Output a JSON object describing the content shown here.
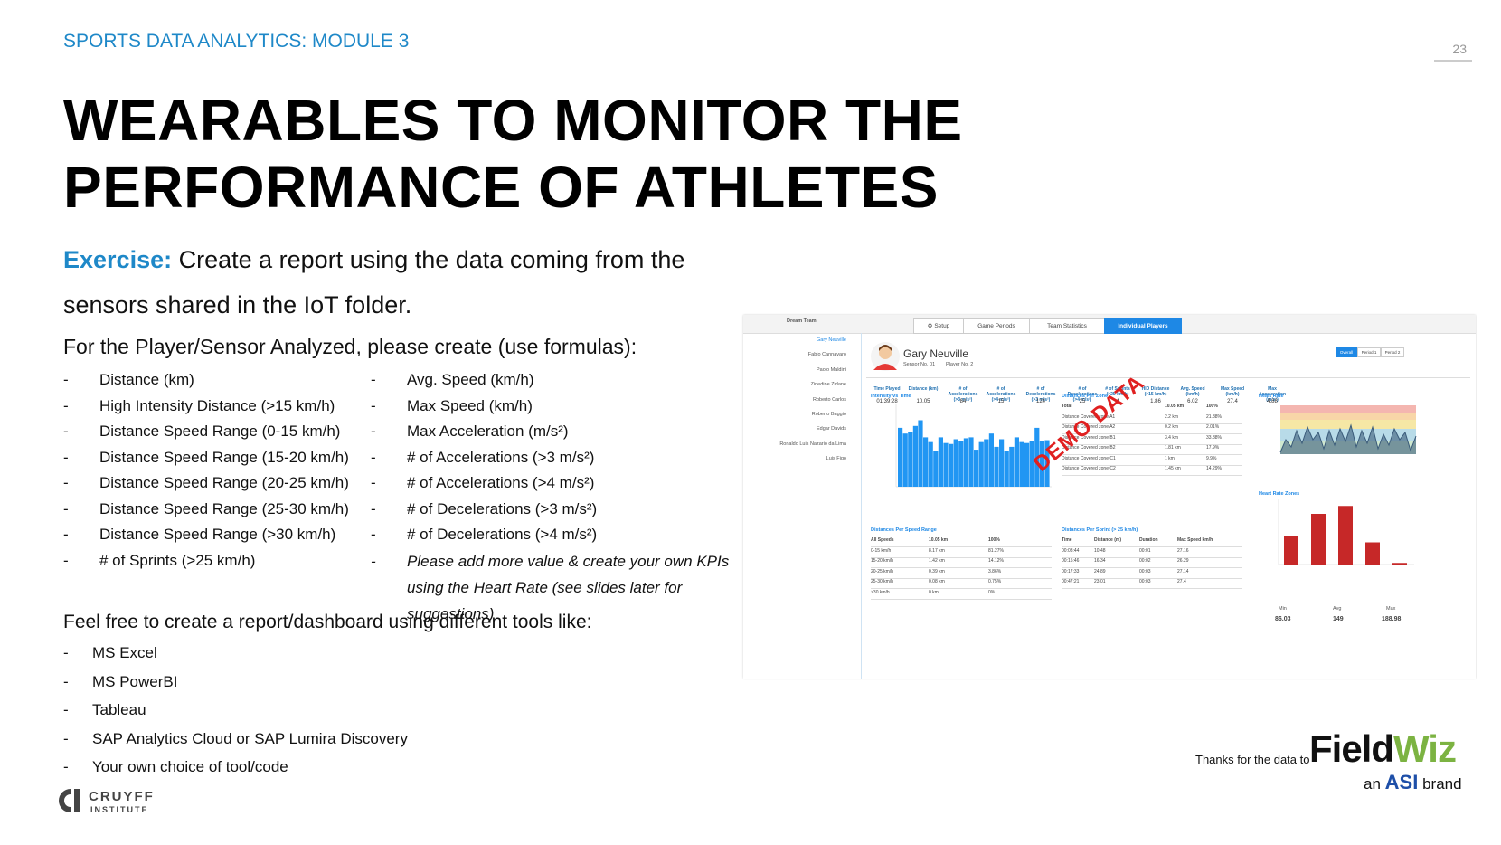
{
  "header": {
    "module": "SPORTS DATA ANALYTICS: MODULE 3",
    "page_number": "23"
  },
  "title": {
    "line1": "WEARABLES TO MONITOR THE",
    "line2": "PERFORMANCE OF ATHLETES"
  },
  "exercise": {
    "label": "Exercise:",
    "text": " Create a report using the data coming from the sensors shared in the IoT folder."
  },
  "analyze_intro": "For the Player/Sensor Analyzed, please create (use formulas):",
  "kpis_left": [
    "Distance (km)",
    "High Intensity Distance (>15 km/h)",
    "Distance Speed Range (0-15 km/h)",
    "Distance Speed Range (15-20 km/h)",
    "Distance Speed Range (20-25 km/h)",
    "Distance Speed Range (25-30 km/h)",
    "Distance Speed Range (>30 km/h)",
    "# of Sprints (>25 km/h)"
  ],
  "kpis_right": [
    "Avg. Speed (km/h)",
    "Max Speed (km/h)",
    "Max Acceleration (m/s²)",
    "# of Accelerations (>3 m/s²)",
    "# of Accelerations (>4 m/s²)",
    "# of Decelerations (>3 m/s²)",
    "# of Decelerations (>4 m/s²)"
  ],
  "kpis_note": "Please add more value & create your own KPIs using the Heart Rate (see slides later for suggestions)",
  "tools_intro": "Feel free to create a report/dashboard using different tools like:",
  "tools": [
    "MS Excel",
    "MS PowerBI",
    "Tableau",
    "SAP Analytics Cloud or SAP Lumira Discovery",
    "Your own choice of tool/code"
  ],
  "footer": {
    "thanks": "Thanks for the data to",
    "brand_a": "Field",
    "brand_b": "Wiz",
    "sub_pre": "an",
    "sub_asi": "ASI",
    "sub_post": "brand",
    "logo_top": "CRUYFF",
    "logo_bottom": "INSTITUTE"
  },
  "dashboard": {
    "team": "Dream Team",
    "tabs": [
      "Setup",
      "Game Periods",
      "Team Statistics",
      "Individual Players"
    ],
    "players": [
      "Gary Neuville",
      "Fabio Cannavaro",
      "Paolo Maldini",
      "Zinedine Zidane",
      "Roberto Carlos",
      "Roberto Baggio",
      "Edgar Davids",
      "Ronaldo Luis Nazario da Lima",
      "Luis Figo"
    ],
    "player_name": "Gary Neuville",
    "sensor": "Sensor No. 01",
    "player_no": "Player No. 2",
    "period_buttons": [
      "Overall",
      "Period 1",
      "Period 2"
    ],
    "stats_labels": [
      "Time Played",
      "Distance (km)",
      "# of Accelerations (>3 m/s²)",
      "# of Accelerations (>4 m/s²)",
      "# of Decelerations (>3 m/s²)",
      "# of Decelerations (>4 m/s²)",
      "# of Sprints (>25 km/h)",
      "HID Distance (>15 km/h)",
      "Avg. Speed (km/h)",
      "Max Speed (km/h)",
      "Max Acceleration (m/s²)"
    ],
    "stats_values": [
      "01:39:28",
      "10.05",
      "84",
      "15",
      "124",
      "25",
      "4",
      "1.86",
      "6.02",
      "27.4",
      "4.88"
    ],
    "intensity_title": "Intensity vs Time",
    "distances_zone_title": "Distances Per Zone",
    "heart_rate_title": "Heart Rate",
    "heart_zones_title": "Heart Rate Zones",
    "speed_range_title": "Distances Per Speed Range",
    "sprint_title": "Distances Per Sprint (> 25 km/h)",
    "demo": "DEMO DATA",
    "hr_min_label": "Min",
    "hr_min": "86.03",
    "hr_avg_label": "Avg",
    "hr_avg": "149",
    "hr_max_label": "Max",
    "hr_max": "188.98",
    "intensity_values": [
      620,
      560,
      580,
      640,
      700,
      520,
      470,
      380,
      520,
      460,
      450,
      500,
      480,
      510,
      520,
      390,
      470,
      500,
      560,
      420,
      500,
      380,
      420,
      520,
      470,
      460,
      480,
      620,
      480,
      490
    ],
    "hr_zone_values": [
      18,
      32,
      37,
      14,
      1
    ],
    "speed_range_rows": [
      [
        "All Speeds",
        "10.05 km",
        "100%"
      ],
      [
        "0-15 km/h",
        "8.17 km",
        "81.27%"
      ],
      [
        "15-20 km/h",
        "1.42 km",
        "14.12%"
      ],
      [
        "20-25 km/h",
        "0.39 km",
        "3.86%"
      ],
      [
        "25-30 km/h",
        "0.08 km",
        "0.75%"
      ],
      [
        ">30 km/h",
        "0 km",
        "0%"
      ]
    ],
    "sprint_rows": [
      [
        "Time",
        "Distance (m)",
        "Duration",
        "Max Speed km/h"
      ],
      [
        "00:03:44",
        "10.48",
        "00:01",
        "27.16"
      ],
      [
        "00:15:46",
        "16.34",
        "00:02",
        "26.29"
      ],
      [
        "00:17:33",
        "24.89",
        "00:03",
        "27.14"
      ],
      [
        "00:47:21",
        "23.01",
        "00:03",
        "27.4"
      ]
    ],
    "zone_rows": [
      [
        "Total",
        "10.05 km",
        "100%"
      ],
      [
        "Distance Covered zone A1",
        "2.2 km",
        "21.88%"
      ],
      [
        "Distance Covered zone A2",
        "0.2 km",
        "2.01%"
      ],
      [
        "Distance Covered zone B1",
        "3.4 km",
        "33.88%"
      ],
      [
        "Distance Covered zone B2",
        "1.81 km",
        "17.9%"
      ],
      [
        "Distance Covered zone C1",
        "1 km",
        "9.9%"
      ],
      [
        "Distance Covered zone C2",
        "1.45 km",
        "14.29%"
      ]
    ]
  }
}
